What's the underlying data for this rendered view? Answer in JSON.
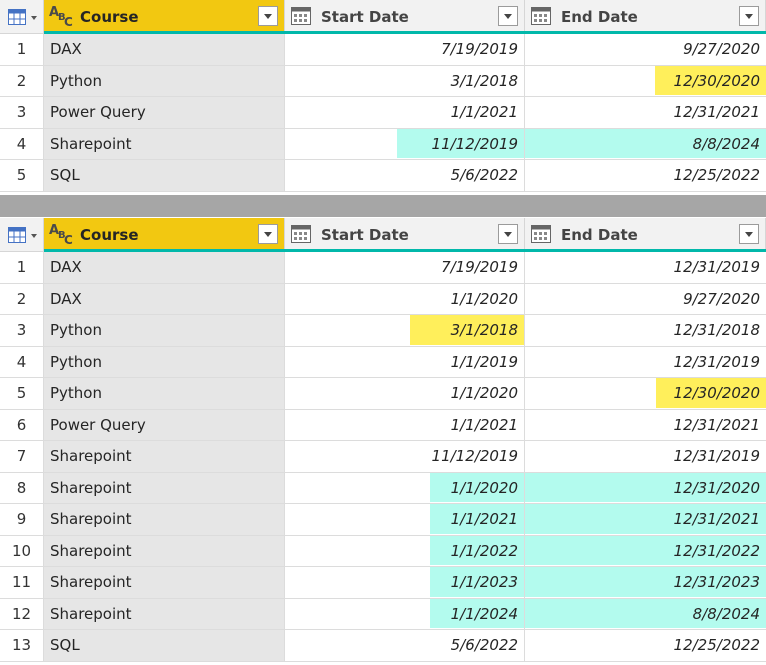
{
  "colors": {
    "highlight_yellow": "#ffef5b",
    "highlight_teal": "#b3fbee",
    "selected_header": "#f2c811",
    "accent_teal": "#01b8aa"
  },
  "columns": {
    "course": "Course",
    "start_date": "Start Date",
    "end_date": "End Date"
  },
  "icons": {
    "table": "table-menu-icon",
    "text_type": "abc-text-type-icon",
    "date_type": "calendar-date-type-icon",
    "dropdown": "filter-dropdown-icon"
  },
  "top_table": {
    "rows": [
      {
        "num": "1",
        "course": "DAX",
        "start": "7/19/2019",
        "end": "9/27/2020"
      },
      {
        "num": "2",
        "course": "Python",
        "start": "3/1/2018",
        "end": "12/30/2020"
      },
      {
        "num": "3",
        "course": "Power Query",
        "start": "1/1/2021",
        "end": "12/31/2021"
      },
      {
        "num": "4",
        "course": "Sharepoint",
        "start": "11/12/2019",
        "end": "8/8/2024"
      },
      {
        "num": "5",
        "course": "SQL",
        "start": "5/6/2022",
        "end": "12/25/2022"
      }
    ]
  },
  "bottom_table": {
    "rows": [
      {
        "num": "1",
        "course": "DAX",
        "start": "7/19/2019",
        "end": "12/31/2019"
      },
      {
        "num": "2",
        "course": "DAX",
        "start": "1/1/2020",
        "end": "9/27/2020"
      },
      {
        "num": "3",
        "course": "Python",
        "start": "3/1/2018",
        "end": "12/31/2018"
      },
      {
        "num": "4",
        "course": "Python",
        "start": "1/1/2019",
        "end": "12/31/2019"
      },
      {
        "num": "5",
        "course": "Python",
        "start": "1/1/2020",
        "end": "12/30/2020"
      },
      {
        "num": "6",
        "course": "Power Query",
        "start": "1/1/2021",
        "end": "12/31/2021"
      },
      {
        "num": "7",
        "course": "Sharepoint",
        "start": "11/12/2019",
        "end": "12/31/2019"
      },
      {
        "num": "8",
        "course": "Sharepoint",
        "start": "1/1/2020",
        "end": "12/31/2020"
      },
      {
        "num": "9",
        "course": "Sharepoint",
        "start": "1/1/2021",
        "end": "12/31/2021"
      },
      {
        "num": "10",
        "course": "Sharepoint",
        "start": "1/1/2022",
        "end": "12/31/2022"
      },
      {
        "num": "11",
        "course": "Sharepoint",
        "start": "1/1/2023",
        "end": "12/31/2023"
      },
      {
        "num": "12",
        "course": "Sharepoint",
        "start": "1/1/2024",
        "end": "8/8/2024"
      },
      {
        "num": "13",
        "course": "SQL",
        "start": "5/6/2022",
        "end": "12/25/2022"
      }
    ]
  }
}
